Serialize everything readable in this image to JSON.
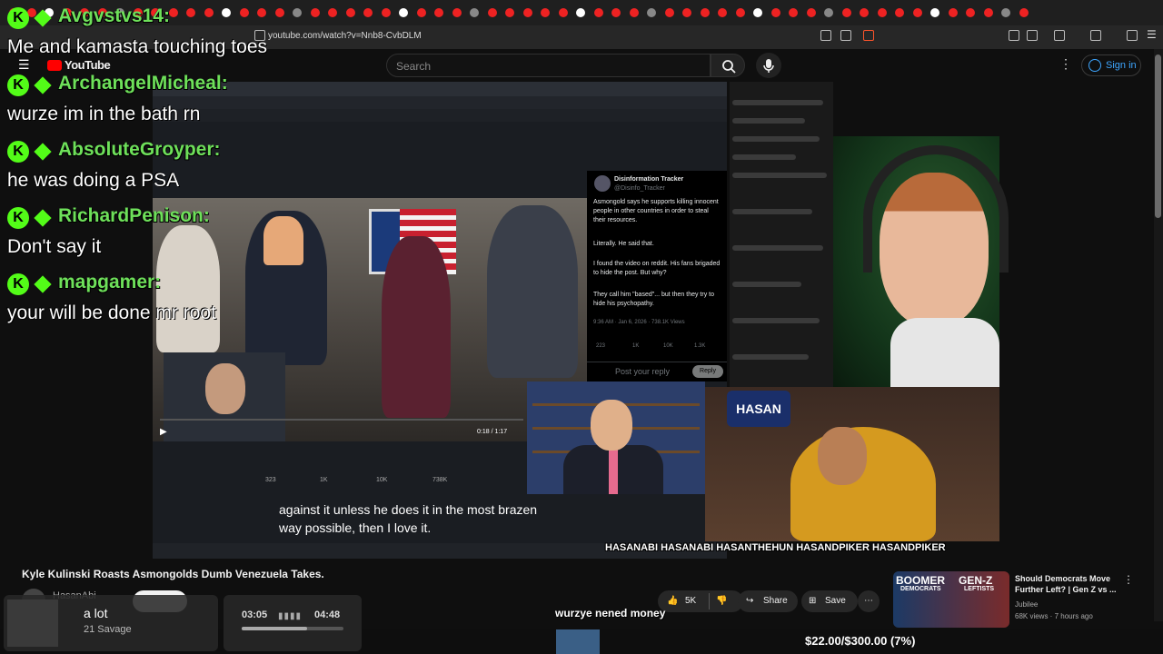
{
  "browser": {
    "url": "youtube.com/watch?v=Nnb8-CvbDLM"
  },
  "youtube": {
    "logo": "YouTube",
    "search_placeholder": "Search",
    "sign_in": "Sign in",
    "video_title": "Kyle Kulinski Roasts Asmongolds Dumb Venezuela Takes.",
    "channel_name": "HasanAbi",
    "actions": {
      "likes": "5K",
      "share": "Share",
      "save": "Save"
    }
  },
  "chat": [
    {
      "user": "Avgvstvs14:",
      "message": "Me and kamasta touching toes",
      "color": "#6ee05a"
    },
    {
      "user": "ArchangelMicheal:",
      "message": "wurze im in the bath rn",
      "color": "#6ee05a"
    },
    {
      "user": "AbsoluteGroyper:",
      "message": "he was doing a PSA",
      "color": "#6ee05a"
    },
    {
      "user": "RichardPenison:",
      "message": "Don't say it",
      "color": "#6ee05a"
    },
    {
      "user": "mapgamer:",
      "message": "your will be done mr root",
      "color": "#6ee05a"
    }
  ],
  "inner_video": {
    "tweet": {
      "name": "Disinformation Tracker",
      "handle": "@Disinfo_Tracker",
      "body1": "Asmongold says he supports killing innocent people in other countries in order to steal their resources.",
      "body2": "Literally. He said that.",
      "body3": "I found the video on reddit. His fans brigaded to hide the post. But why?",
      "body4": "They call him \"based\"... but then they try to hide his psychopathy.",
      "meta": "9:36 AM · Jan 6, 2026 · 738.1K Views",
      "stats": [
        "223",
        "1K",
        "10K",
        "1.3K"
      ],
      "reply_placeholder": "Post your reply",
      "reply_button": "Reply"
    },
    "timecode": "0:18 / 1:17",
    "post_actions": [
      "323",
      "1K",
      "10K",
      "738K"
    ],
    "caption": "against it unless he does it in the most brazen way possible, then I love it."
  },
  "overlays": {
    "socials": "HASANABI HASANABI HASANTHEHUN HASANDPIKER HASANDPIKER",
    "hasan_logo": "HASAN",
    "song": {
      "title": "a lot",
      "artist": "21 Savage"
    },
    "time": {
      "current": "03:05",
      "total": "04:48",
      "progress": 0.64
    },
    "ticker": "wurzye nened money",
    "goal": "$22.00/$300.00 (7%)"
  },
  "recommended": {
    "thumb_left": "BOOMER",
    "thumb_left_sub": "DEMOCRATS",
    "thumb_right": "GEN-Z",
    "thumb_right_sub": "LEFTISTS",
    "title": "Should Democrats Move Further Left? | Gen Z vs ...",
    "channel": "Jubilee",
    "meta": "68K views · 7 hours ago"
  },
  "colors": {
    "kick_green": "#53fc18",
    "link_blue": "#3ea6ff"
  }
}
